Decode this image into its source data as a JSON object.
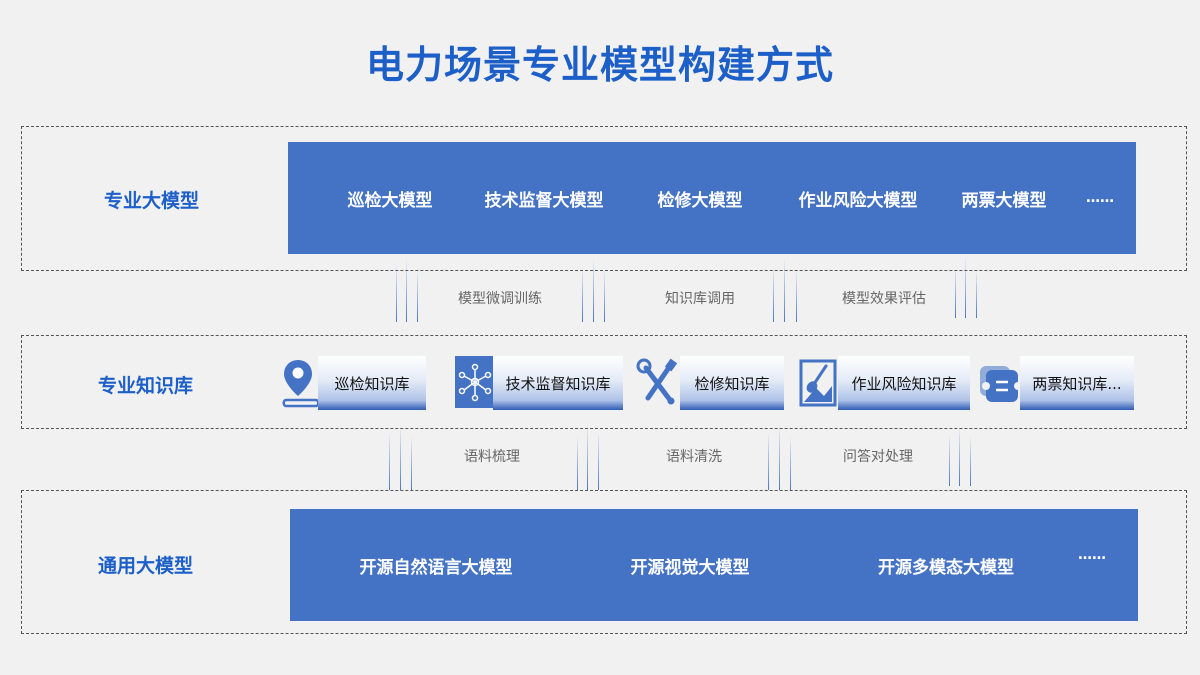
{
  "title": "电力场景专业模型构建方式",
  "tiers": {
    "expert": {
      "label": "专业大模型",
      "items": [
        "巡检大模型",
        "技术监督大模型",
        "检修大模型",
        "作业风险大模型",
        "两票大模型",
        "……"
      ]
    },
    "knowledge_base": {
      "label": "专业知识库",
      "items": [
        {
          "label": "巡检知识库",
          "icon": "location-pin-icon"
        },
        {
          "label": "技术监督知识库",
          "icon": "network-nodes-icon"
        },
        {
          "label": "检修知识库",
          "icon": "wrench-screwdriver-icon"
        },
        {
          "label": "作业风险知识库",
          "icon": "shovel-image-icon"
        },
        {
          "label": "两票知识库...",
          "icon": "ticket-icon"
        }
      ]
    },
    "general": {
      "label": "通用大模型",
      "items": [
        "开源自然语言大模型",
        "开源视觉大模型",
        "开源多模态大模型",
        "……"
      ]
    }
  },
  "connectors": {
    "upper": [
      "模型微调训练",
      "知识库调用",
      "模型效果评估"
    ],
    "lower": [
      "语料梳理",
      "语料清洗",
      "问答对处理"
    ]
  },
  "colors": {
    "title": "#1d5fc9",
    "bar_fill": "#4472c4",
    "icon_fill": "#4472c4"
  }
}
